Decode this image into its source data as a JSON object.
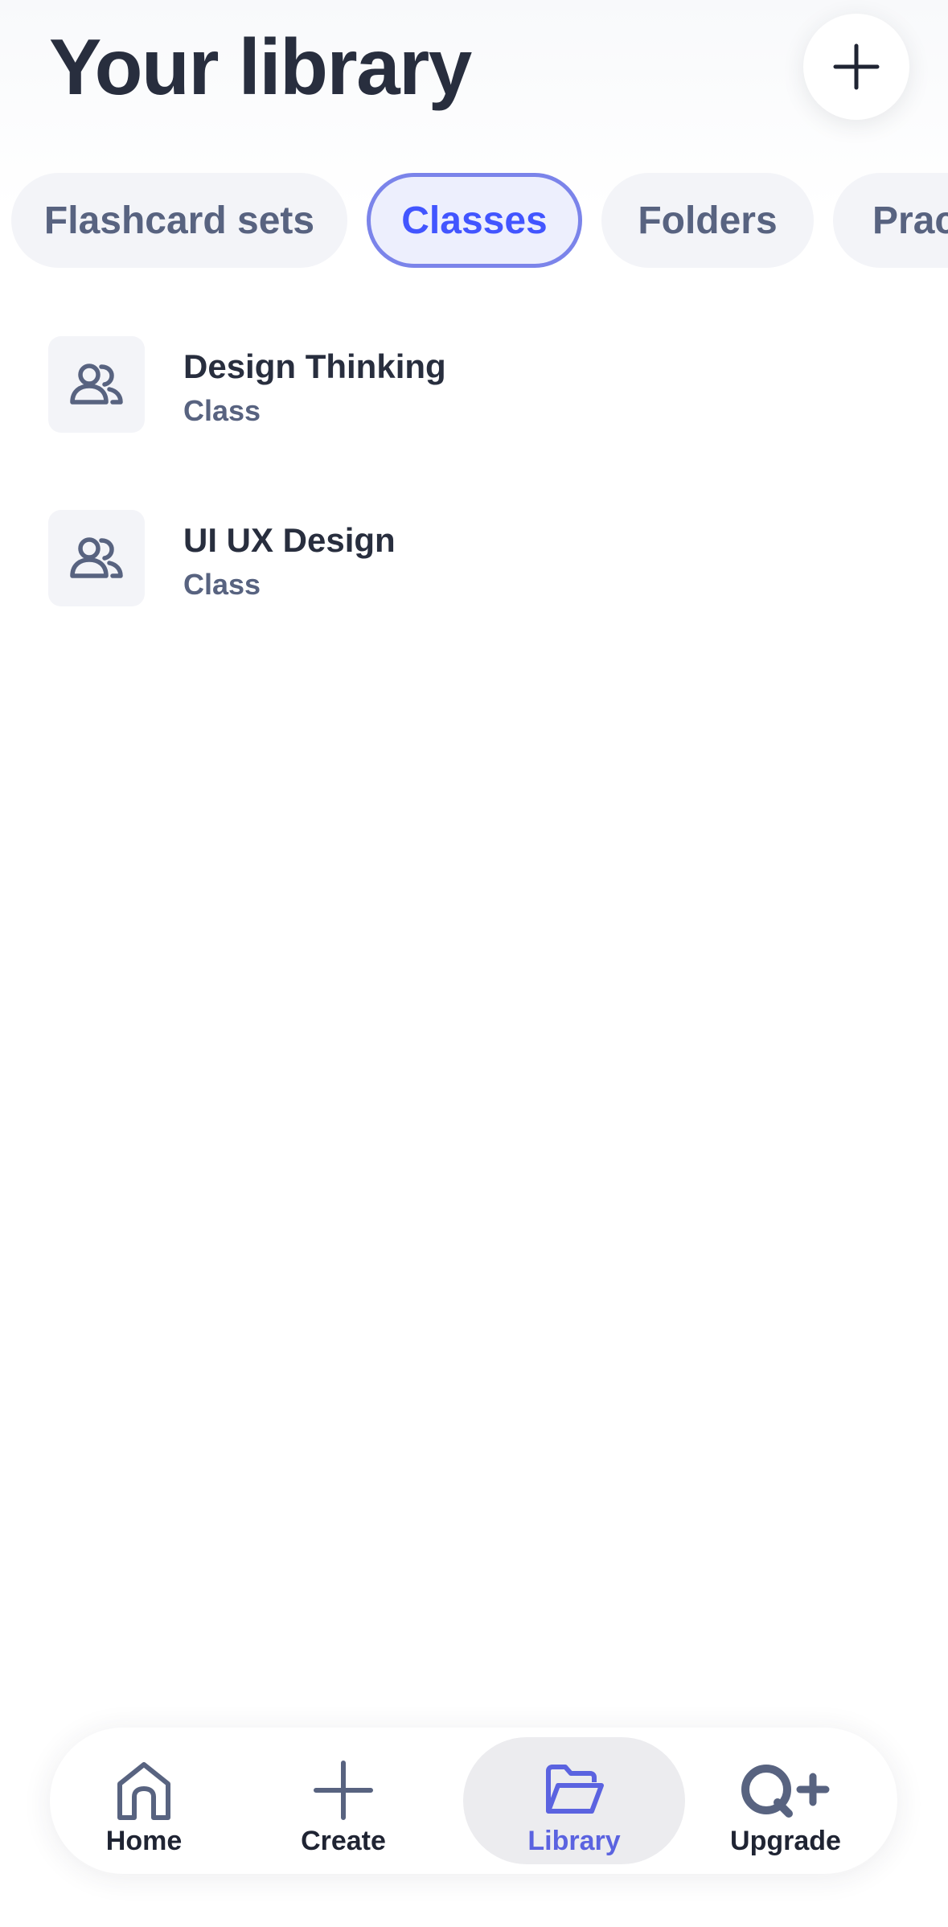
{
  "header": {
    "title": "Your library",
    "add_icon": "plus-icon"
  },
  "tabs": [
    {
      "label": "Flashcard sets",
      "active": false
    },
    {
      "label": "Classes",
      "active": true
    },
    {
      "label": "Folders",
      "active": false
    },
    {
      "label": "Prac",
      "active": false
    }
  ],
  "classes": [
    {
      "title": "Design Thinking",
      "subtitle": "Class",
      "icon": "people-icon"
    },
    {
      "title": "UI UX Design",
      "subtitle": "Class",
      "icon": "people-icon"
    }
  ],
  "bottom_nav": [
    {
      "label": "Home",
      "icon": "home-icon",
      "active": false
    },
    {
      "label": "Create",
      "icon": "plus-icon",
      "active": false
    },
    {
      "label": "Library",
      "icon": "folder-icon",
      "active": true
    },
    {
      "label": "Upgrade",
      "icon": "upgrade-icon",
      "active": false
    }
  ],
  "colors": {
    "accent": "#4255ff",
    "title": "#282e3e",
    "muted": "#586380",
    "chip_bg": "#f3f4f8"
  }
}
